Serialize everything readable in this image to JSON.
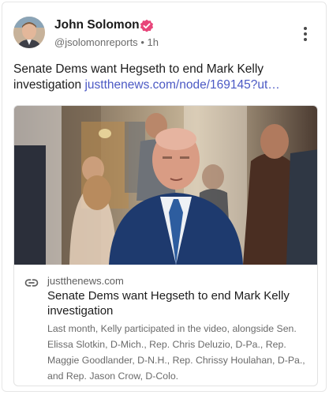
{
  "author": {
    "name": "John Solomon",
    "handle": "@jsolomonreports",
    "separator": "•",
    "time": "1h",
    "verified_color": "#e8457a"
  },
  "post": {
    "text": "Senate Dems want Hegseth to end Mark Kelly investigation",
    "link_text": "justthenews.com/node/169145?ut…",
    "link_color": "#4b59c4"
  },
  "preview": {
    "domain": "justthenews.com",
    "title": "Senate Dems want Hegseth to end Mark Kelly investigation",
    "description": "Last month, Kelly participated in the video, alongside Sen. Elissa Slotkin, D-Mich., Rep. Chris Deluzio, D-Pa., Rep. Maggie Goodlander, D-N.H., Rep. Chrissy Houlahan, D-Pa., and Rep. Jason Crow, D-Colo."
  },
  "icons": {
    "verified": "verified-badge-icon",
    "more": "more-vertical-icon",
    "link": "link-icon"
  }
}
